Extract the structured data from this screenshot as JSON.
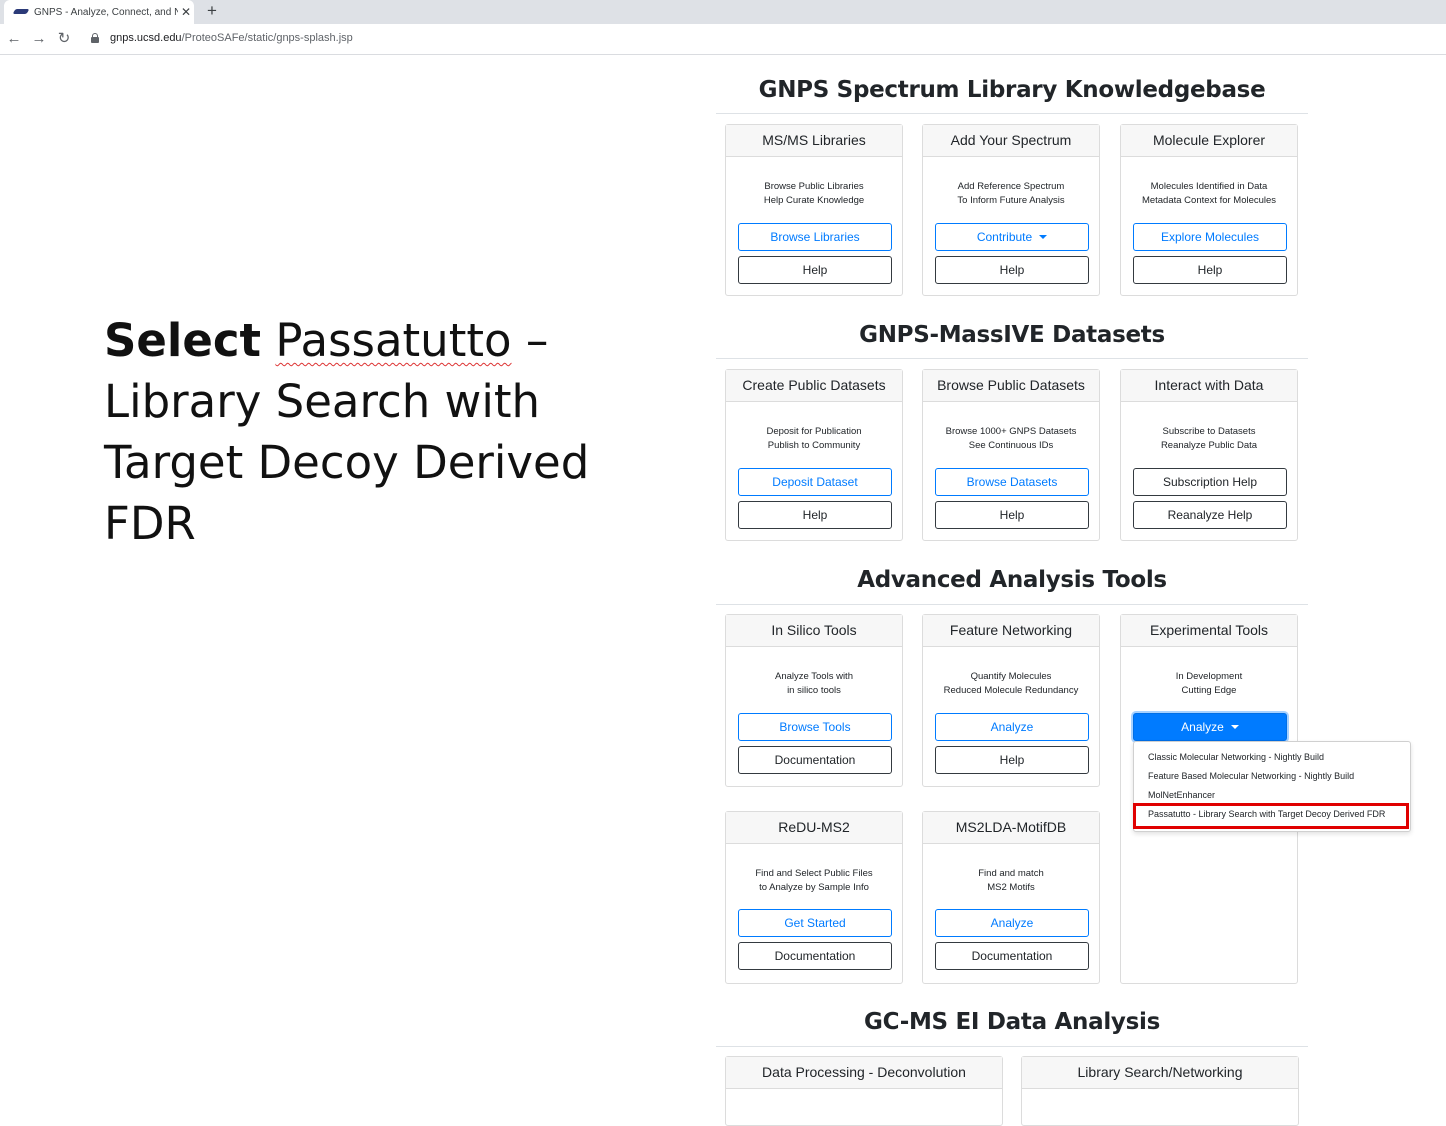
{
  "browser": {
    "tab_title": "GNPS - Analyze, Connect, and Ne",
    "url_host": "gnps.ucsd.edu",
    "url_path": "/ProteoSAFe/static/gnps-splash.jsp"
  },
  "instruction": {
    "select_word": "Select",
    "tool_word": "Passatutto",
    "dash": " –",
    "line2": "Library Search with",
    "line3": "Target Decoy Derived FDR"
  },
  "sections": {
    "library": "GNPS Spectrum Library Knowledgebase",
    "massive": "GNPS-MassIVE Datasets",
    "advanced": "Advanced Analysis Tools",
    "gcms": "GC-MS EI Data Analysis"
  },
  "cards": {
    "msms": {
      "title": "MS/MS Libraries",
      "line1": "Browse Public Libraries",
      "line2": "Help Curate Knowledge",
      "btn1": "Browse Libraries",
      "btn2": "Help"
    },
    "add": {
      "title": "Add Your Spectrum",
      "line1": "Add Reference Spectrum",
      "line2": "To Inform Future Analysis",
      "btn1": "Contribute",
      "btn2": "Help"
    },
    "molecule": {
      "title": "Molecule Explorer",
      "line1": "Molecules Identified in Data",
      "line2": "Metadata Context for Molecules",
      "btn1": "Explore Molecules",
      "btn2": "Help"
    },
    "create": {
      "title": "Create Public Datasets",
      "line1": "Deposit for Publication",
      "line2": "Publish to Community",
      "btn1": "Deposit Dataset",
      "btn2": "Help"
    },
    "browse": {
      "title": "Browse Public Datasets",
      "line1": "Browse 1000+ GNPS Datasets",
      "line2": "See Continuous IDs",
      "btn1": "Browse Datasets",
      "btn2": "Help"
    },
    "interact": {
      "title": "Interact with Data",
      "line1": "Subscribe to Datasets",
      "line2": "Reanalyze Public Data",
      "btn1": "Subscription Help",
      "btn2": "Reanalyze Help"
    },
    "insilico": {
      "title": "In Silico Tools",
      "line1": "Analyze Tools with",
      "line2": "in silico tools",
      "btn1": "Browse Tools",
      "btn2": "Documentation"
    },
    "feature": {
      "title": "Feature Networking",
      "line1": "Quantify Molecules",
      "line2": "Reduced Molecule Redundancy",
      "btn1": "Analyze",
      "btn2": "Help"
    },
    "experimental": {
      "title": "Experimental Tools",
      "line1": "In Development",
      "line2": "Cutting Edge",
      "btn1": "Analyze"
    },
    "redu": {
      "title": "ReDU-MS2",
      "line1": "Find and Select Public Files",
      "line2": "to Analyze by Sample Info",
      "btn1": "Get Started",
      "btn2": "Documentation"
    },
    "ms2lda": {
      "title": "MS2LDA-MotifDB",
      "line1": "Find and match",
      "line2": "MS2 Motifs",
      "btn1": "Analyze",
      "btn2": "Documentation"
    },
    "deconv": {
      "title": "Data Processing - Deconvolution"
    },
    "libsearch": {
      "title": "Library Search/Networking"
    }
  },
  "dropdown": {
    "items": [
      "Classic Molecular Networking - Nightly Build",
      "Feature Based Molecular Networking - Nightly Build",
      "MolNetEnhancer",
      "Passatutto - Library Search with Target Decoy Derived FDR"
    ],
    "highlight_color": "#e00000"
  },
  "colors": {
    "primary": "#007bff",
    "dark": "#343a40"
  }
}
